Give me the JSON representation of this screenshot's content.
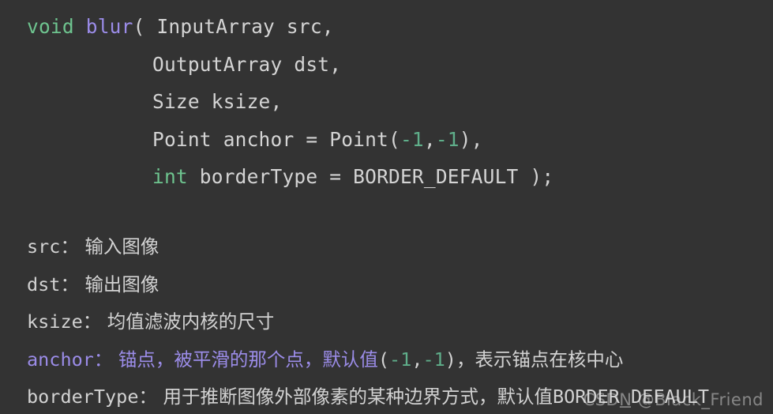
{
  "theme": {
    "background": "#333333",
    "default_text": "#d2d2d2",
    "keyword_green": "#6ec48f",
    "function_purple": "#9b8ce8",
    "number_green": "#5fae8a"
  },
  "code": {
    "lines": [
      {
        "indent": 0,
        "tokens": [
          {
            "text": "void",
            "kind": "keyword"
          },
          {
            "text": " ",
            "kind": "plain"
          },
          {
            "text": "blur",
            "kind": "function"
          },
          {
            "text": "( InputArray src,",
            "kind": "plain"
          }
        ]
      },
      {
        "indent": 1,
        "tokens": [
          {
            "text": "OutputArray dst,",
            "kind": "plain"
          }
        ]
      },
      {
        "indent": 1,
        "tokens": [
          {
            "text": "Size ksize,",
            "kind": "plain"
          }
        ]
      },
      {
        "indent": 1,
        "tokens": [
          {
            "text": "Point anchor = Point(",
            "kind": "plain"
          },
          {
            "text": "-1",
            "kind": "number"
          },
          {
            "text": ",",
            "kind": "plain"
          },
          {
            "text": "-1",
            "kind": "number"
          },
          {
            "text": "),",
            "kind": "plain"
          }
        ]
      },
      {
        "indent": 1,
        "tokens": [
          {
            "text": "int",
            "kind": "keyword"
          },
          {
            "text": " borderType = BORDER_DEFAULT );",
            "kind": "plain"
          }
        ]
      }
    ]
  },
  "descriptions": {
    "items": [
      {
        "name": "src：",
        "accent": false,
        "parts": [
          {
            "text": "输入图像",
            "kind": "text"
          }
        ]
      },
      {
        "name": "dst：",
        "accent": false,
        "parts": [
          {
            "text": "输出图像",
            "kind": "text"
          }
        ]
      },
      {
        "name": "ksize：",
        "accent": false,
        "parts": [
          {
            "text": "均值滤波内核的尺寸",
            "kind": "text"
          }
        ]
      },
      {
        "name": "anchor：",
        "accent": true,
        "parts": [
          {
            "text": "锚点，被平滑的那个点，默认值",
            "kind": "accent"
          },
          {
            "text": "(",
            "kind": "mono"
          },
          {
            "text": "-1",
            "kind": "number"
          },
          {
            "text": ",",
            "kind": "mono"
          },
          {
            "text": "-1",
            "kind": "number"
          },
          {
            "text": ")",
            "kind": "mono"
          },
          {
            "text": "，表示锚点在核中心",
            "kind": "text"
          }
        ]
      },
      {
        "name": "borderType：",
        "accent": false,
        "parts": [
          {
            "text": "用于推断图像外部像素的某种边界方式，默认值",
            "kind": "text"
          },
          {
            "text": "BORDER_DEFAULT",
            "kind": "mono"
          }
        ]
      }
    ]
  },
  "watermark": {
    "text": "CSDN @Black_Friend"
  }
}
